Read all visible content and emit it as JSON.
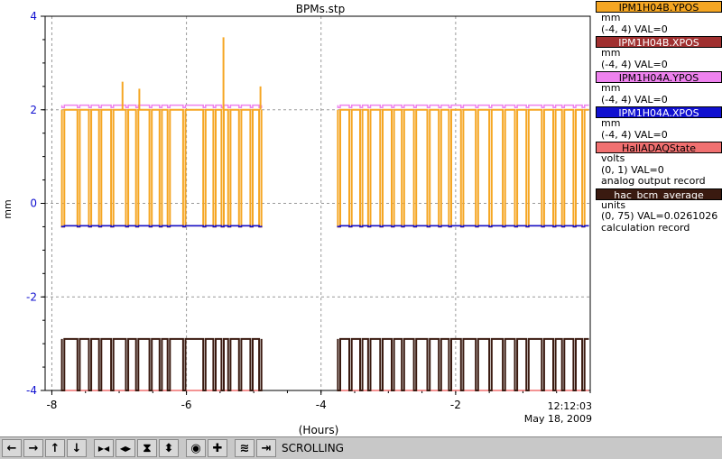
{
  "chart_data": {
    "type": "line",
    "title": "BPMs.stp",
    "ylabel": "mm",
    "xlabel": "(Hours)",
    "xlim": [
      -8.1,
      -0.0
    ],
    "ylim": [
      -4,
      4
    ],
    "x_ticks": [
      -8,
      -6,
      -4,
      -2
    ],
    "y_ticks": [
      4,
      2,
      0,
      -2,
      -4
    ],
    "x_tick_labels": [
      "-8",
      "-6",
      "-4",
      "-2"
    ],
    "y_tick_labels": [
      "4",
      "2",
      "0",
      "-2",
      "-4"
    ],
    "end_time": "12:12:03",
    "end_date": "May 18, 2009",
    "grid": true,
    "series": [
      {
        "name": "IPM1H04B.YPOS",
        "color": "#f5a623",
        "high": 2.0,
        "low": -0.5,
        "baseline": 2.0
      },
      {
        "name": "IPM1H04B.XPOS",
        "color": "#a03030",
        "high": -0.45,
        "low": -0.5,
        "baseline": -0.48
      },
      {
        "name": "IPM1H04A.YPOS",
        "color": "#ee82ee",
        "high": 2.1,
        "low": 2.05,
        "baseline": 2.1
      },
      {
        "name": "IPM1H04A.XPOS",
        "color": "#1010d0",
        "high": 0.0,
        "low": -0.5,
        "baseline": -0.48
      },
      {
        "name": "HallADAQState",
        "color": "#f07070",
        "high": -4.0,
        "low": -4.0,
        "baseline": -4.0
      },
      {
        "name": "hac_bcm_average",
        "color": "#3a1a10",
        "high": -2.9,
        "low": -4.0,
        "baseline": -2.9
      }
    ],
    "spikes": [
      {
        "x": -5.45,
        "y": 3.55
      },
      {
        "x": -6.95,
        "y": 2.6
      },
      {
        "x": -4.9,
        "y": 2.5
      },
      {
        "x": -6.7,
        "y": 2.45
      }
    ],
    "gaps": [
      [
        -8.0,
        -7.98
      ],
      [
        -4.75,
        -4.4
      ],
      [
        -4.02,
        -3.9
      ]
    ],
    "dropouts": [
      -7.85,
      -7.62,
      -7.45,
      -7.3,
      -7.12,
      -6.9,
      -6.75,
      -6.55,
      -6.4,
      -6.28,
      -6.05,
      -5.75,
      -5.6,
      -5.48,
      -5.38,
      -5.22,
      -5.05,
      -4.92,
      -4.72,
      -4.55,
      -3.75,
      -3.58,
      -3.42,
      -3.3,
      -3.12,
      -2.95,
      -2.8,
      -2.62,
      -2.42,
      -2.25,
      -2.1,
      -1.92,
      -1.7,
      -1.5,
      -1.3,
      -1.12,
      -0.95,
      -0.72,
      -0.55,
      -0.42,
      -0.25,
      -0.12
    ]
  },
  "legend": [
    {
      "label": "IPM1H04B.YPOS",
      "color": "#f5a623",
      "lines": [
        "mm",
        "(-4, 4) VAL=0"
      ]
    },
    {
      "label": "IPM1H04B.XPOS",
      "color": "#a03030",
      "lines": [
        "mm",
        "(-4, 4) VAL=0"
      ]
    },
    {
      "label": "IPM1H04A.YPOS",
      "color": "#ee82ee",
      "lines": [
        "mm",
        "(-4, 4) VAL=0"
      ]
    },
    {
      "label": "IPM1H04A.XPOS",
      "color": "#1010d0",
      "lines": [
        "mm",
        "(-4, 4) VAL=0"
      ]
    },
    {
      "label": "HallADAQState",
      "color": "#f07070",
      "lines": [
        "volts",
        "(0, 1) VAL=0",
        "analog output record"
      ]
    },
    {
      "label": "hac_bcm_average",
      "color": "#3a1a10",
      "lines": [
        "units",
        "(0, 75) VAL=0.0261026",
        "calculation record"
      ]
    }
  ],
  "toolbar": {
    "buttons": [
      {
        "icon": "arrow-left-icon",
        "glyph": "←"
      },
      {
        "icon": "arrow-right-icon",
        "glyph": "→"
      },
      {
        "icon": "arrow-up-icon",
        "glyph": "↑"
      },
      {
        "icon": "arrow-down-icon",
        "glyph": "↓"
      },
      {
        "icon": "zoom-in-horizontal-icon",
        "glyph": "▶◀"
      },
      {
        "icon": "zoom-out-horizontal-icon",
        "glyph": "◀▶"
      },
      {
        "icon": "zoom-in-vertical-icon",
        "glyph": "⧗"
      },
      {
        "icon": "zoom-out-vertical-icon",
        "glyph": "⬍"
      },
      {
        "icon": "config-icon",
        "glyph": "◉"
      },
      {
        "icon": "add-icon",
        "glyph": "✚"
      },
      {
        "icon": "autoscale-icon",
        "glyph": "≋"
      },
      {
        "icon": "scroll-mode-icon",
        "glyph": "⇥"
      }
    ],
    "mode_label": "SCROLLING"
  }
}
